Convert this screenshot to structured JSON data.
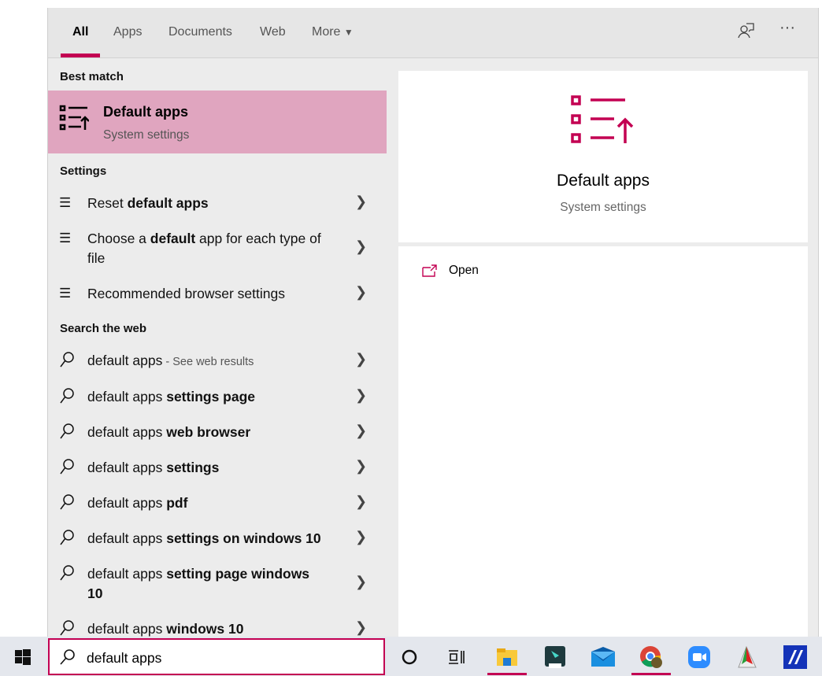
{
  "tabs": [
    "All",
    "Apps",
    "Documents",
    "Web",
    "More"
  ],
  "header_icons": [
    "feedback-icon",
    "more-options-icon"
  ],
  "more_label": "···",
  "best_match": {
    "section": "Best match",
    "title": "Default apps",
    "subtitle": "System settings"
  },
  "settings": {
    "section": "Settings",
    "items": [
      {
        "pre": "Reset ",
        "bold": "default apps",
        "post": ""
      },
      {
        "pre": "Choose a ",
        "bold": "default",
        "post": " app for each type of file"
      },
      {
        "pre": "Recommended browser settings",
        "bold": "",
        "post": ""
      }
    ]
  },
  "web": {
    "section": "Search the web",
    "items": [
      {
        "pre": "default apps",
        "bold": "",
        "post": " - See web results"
      },
      {
        "pre": "default apps ",
        "bold": "settings page"
      },
      {
        "pre": "default apps ",
        "bold": "web browser"
      },
      {
        "pre": "default apps ",
        "bold": "settings"
      },
      {
        "pre": "default apps ",
        "bold": "pdf"
      },
      {
        "pre": "default apps ",
        "bold": "settings on windows 10"
      },
      {
        "pre": "default apps ",
        "bold": "setting page windows 10"
      },
      {
        "pre": "default apps ",
        "bold": "windows 10"
      }
    ]
  },
  "preview": {
    "title": "Default apps",
    "subtitle": "System settings",
    "open_label": "Open"
  },
  "search": {
    "value": "default apps"
  },
  "accent": "#c30052",
  "taskbar_icons": [
    "windows-start-icon",
    "cortana-icon",
    "task-view-icon",
    "file-explorer-icon",
    "filmora-icon",
    "mail-icon",
    "chrome-icon",
    "zoom-icon",
    "app-icon",
    "app-icon-blue"
  ]
}
